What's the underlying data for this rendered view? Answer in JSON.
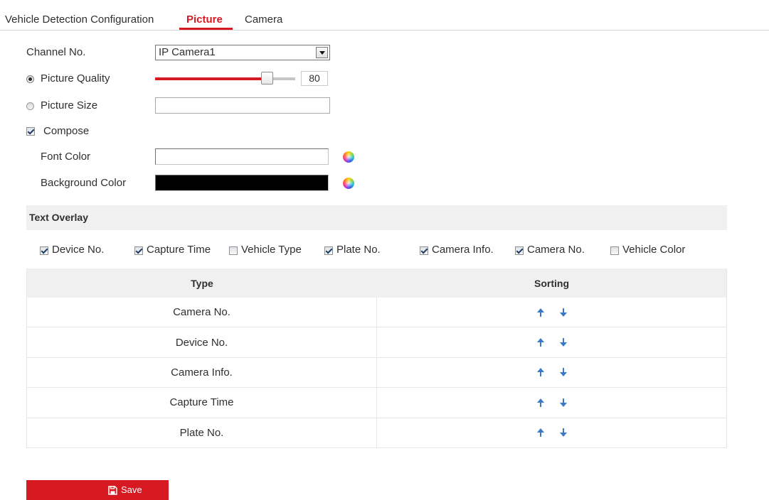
{
  "tabs": [
    {
      "label": "Vehicle Detection Configuration",
      "active": false
    },
    {
      "label": "Picture",
      "active": true
    },
    {
      "label": "Camera",
      "active": false
    }
  ],
  "form": {
    "channel_no": {
      "label": "Channel No.",
      "value": "IP Camera1"
    },
    "picture_quality": {
      "label": "Picture Quality",
      "selected": true,
      "value": 80,
      "level": 0.8
    },
    "picture_size": {
      "label": "Picture Size",
      "selected": false,
      "value": ""
    },
    "compose": {
      "label": "Compose",
      "checked": true
    },
    "font_color": {
      "label": "Font Color",
      "color": "#ffffff"
    },
    "background_color": {
      "label": "Background Color",
      "color": "#000000"
    }
  },
  "text_overlay": {
    "title": "Text Overlay",
    "options": [
      {
        "label": "Device No.",
        "checked": true
      },
      {
        "label": "Capture Time",
        "checked": true
      },
      {
        "label": "Vehicle Type",
        "checked": false
      },
      {
        "label": "Plate No.",
        "checked": true
      },
      {
        "label": "Camera Info.",
        "checked": true
      },
      {
        "label": "Camera No.",
        "checked": true
      },
      {
        "label": "Vehicle Color",
        "checked": false
      }
    ],
    "table": {
      "headers": [
        "Type",
        "Sorting"
      ],
      "rows": [
        "Camera No.",
        "Device No.",
        "Camera Info.",
        "Capture Time",
        "Plate No."
      ]
    }
  },
  "save_button": {
    "label": "Save"
  },
  "icons": {
    "dropdown": "chevron-down-icon",
    "color_picker": "color-wheel-icon",
    "sort_up": "arrow-up-icon",
    "sort_down": "arrow-down-icon",
    "save": "floppy-disk-icon"
  },
  "colors": {
    "accent": "#d71a21",
    "sort_arrow": "#3b78c8",
    "section_bg": "#f0f0f0",
    "text": "#2f2f2f"
  }
}
